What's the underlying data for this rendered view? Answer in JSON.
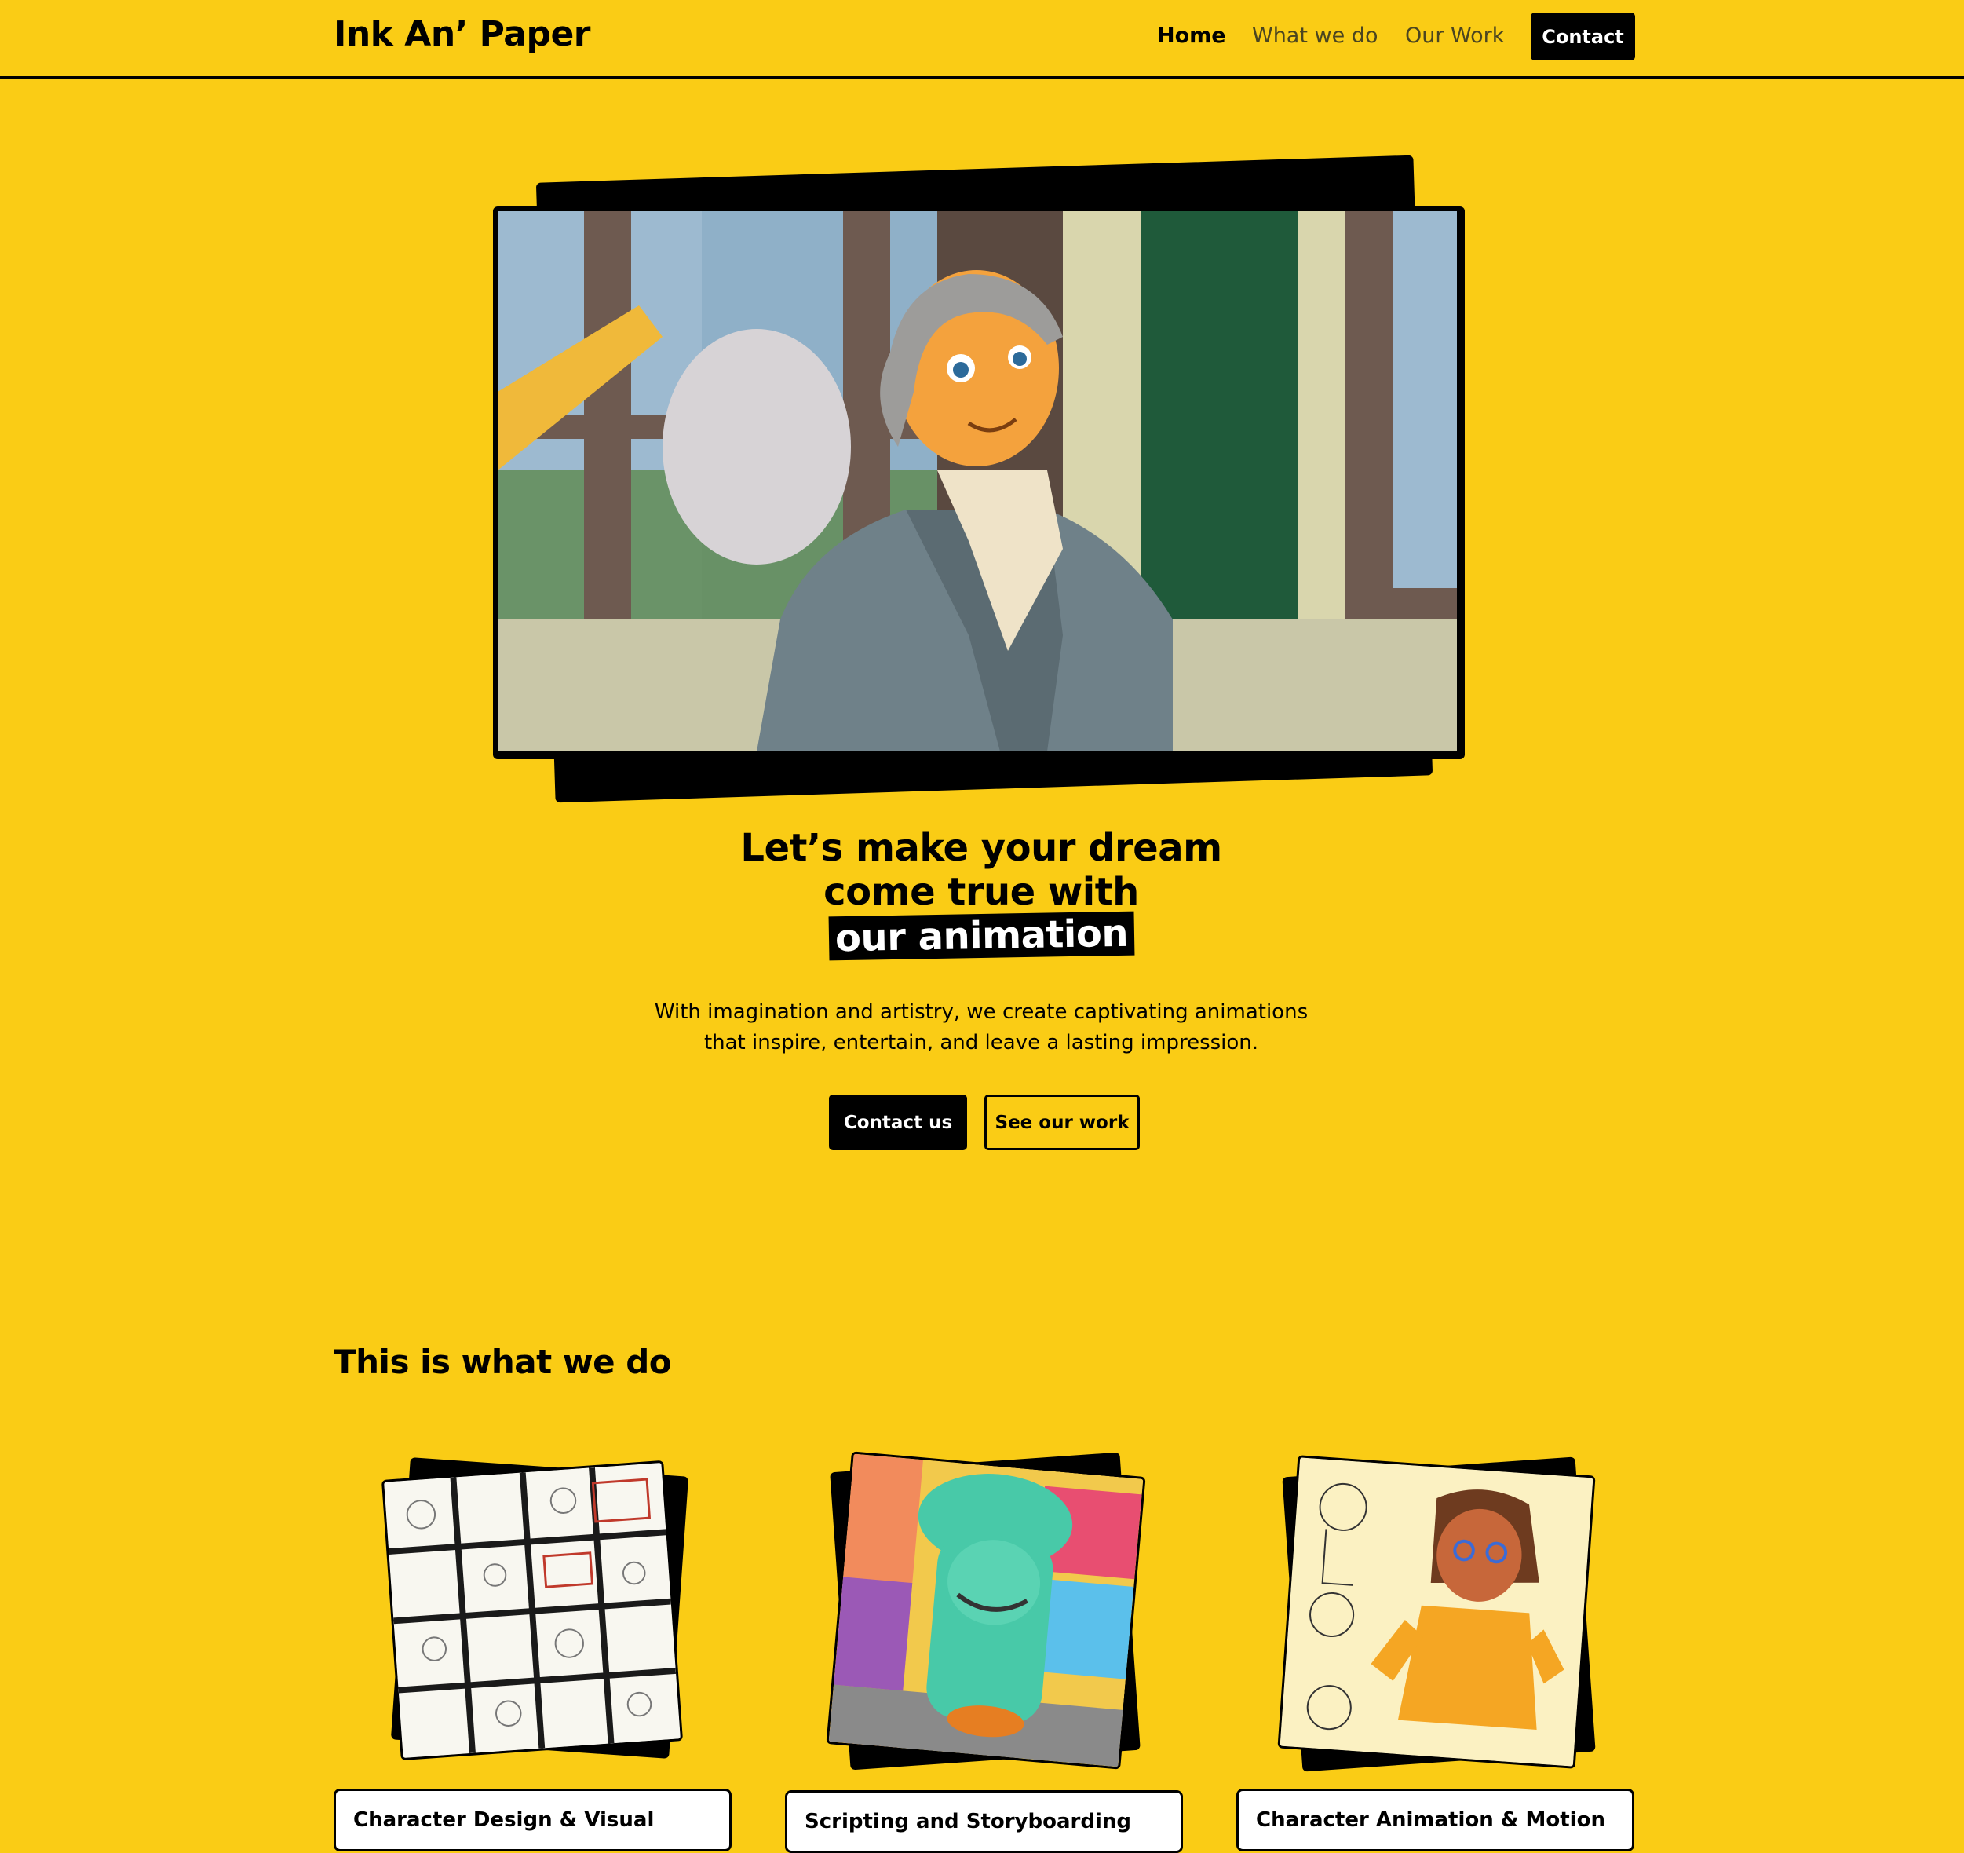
{
  "nav": {
    "logo": "Ink An’ Paper",
    "links": [
      "Home",
      "What we do",
      "Our Work"
    ],
    "contact_label": "Contact"
  },
  "hero": {
    "headline_line1": "Let’s make your dream",
    "headline_line2": "come true with",
    "headline_highlight": "our animation",
    "subtext_line1": "With imagination and artistry, we create captivating animations",
    "subtext_line2": "that inspire, entertain, and leave a lasting impression.",
    "primary_button": "Contact us",
    "secondary_button": "See our work"
  },
  "services": {
    "title": "This is what we do",
    "cards": [
      "Character Design & Visual",
      "Scripting and Storyboarding",
      "Character Animation & Motion"
    ]
  },
  "colors": {
    "background": "#facc15",
    "ink": "#000000",
    "card": "#ffffff"
  }
}
